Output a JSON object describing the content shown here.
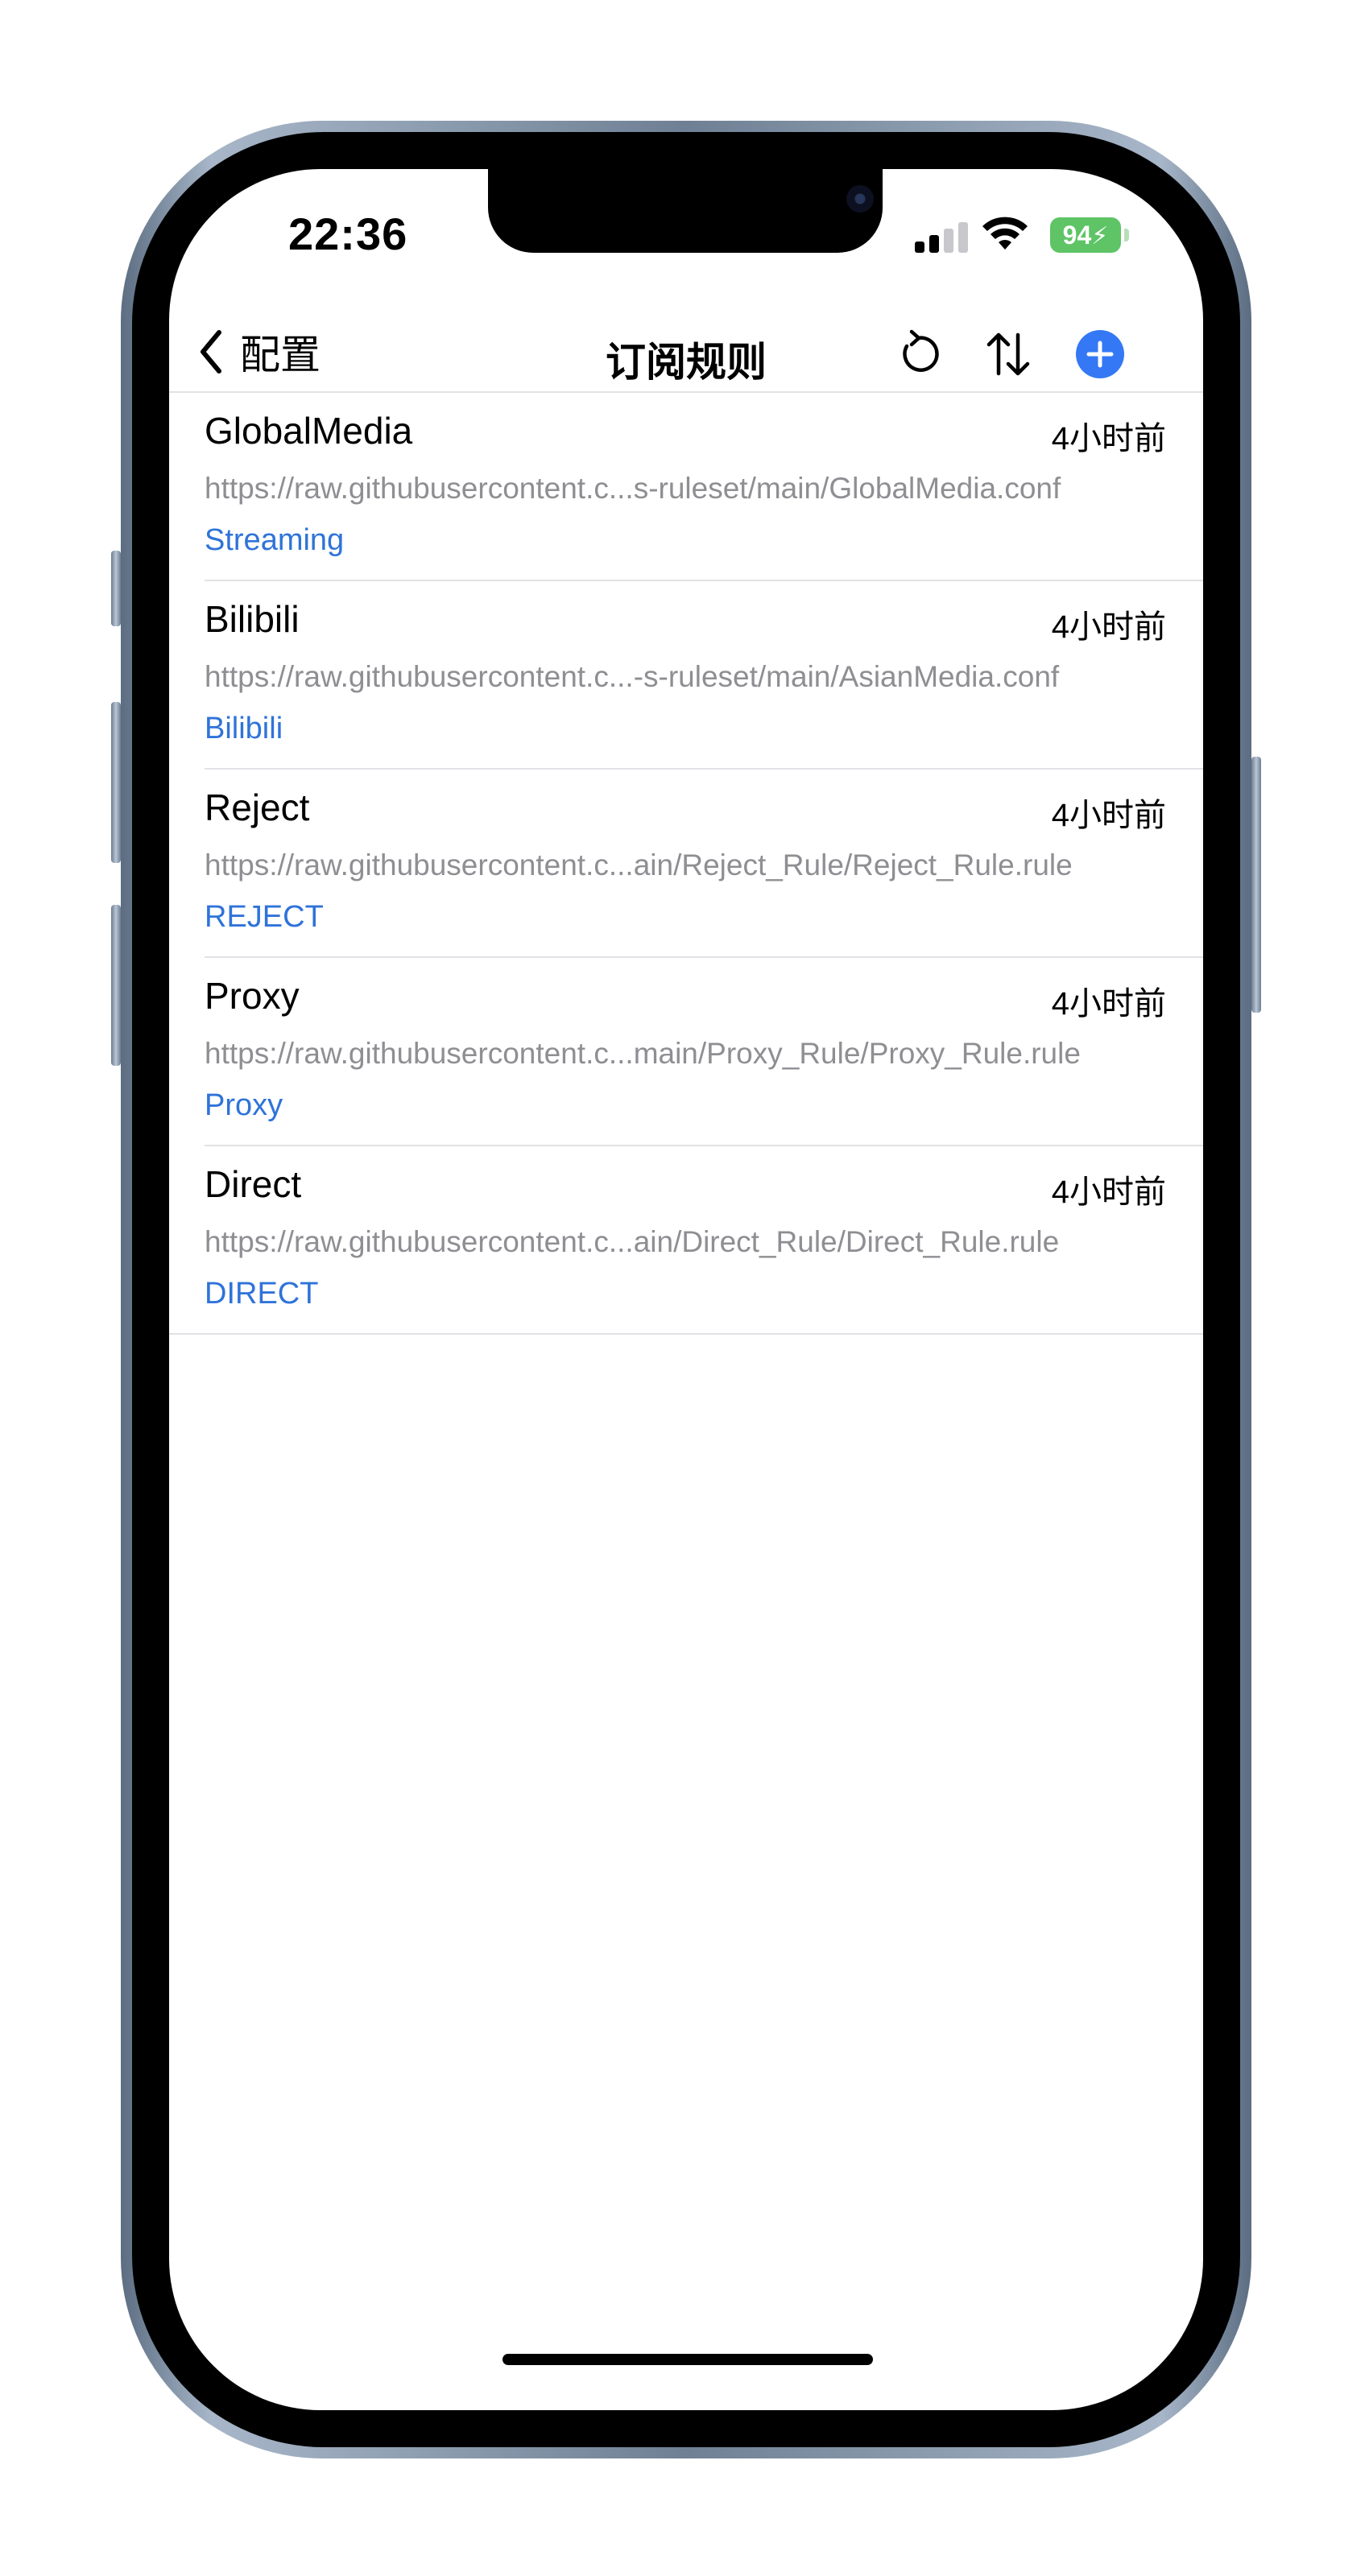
{
  "status_bar": {
    "time": "22:36",
    "battery": "94",
    "battery_color": "#5ec466"
  },
  "nav": {
    "back_label": "配置",
    "title": "订阅规则",
    "icons": [
      "chevron-left-icon",
      "refresh-icon",
      "sort-icon",
      "add-icon"
    ],
    "accent_color": "#3478f6"
  },
  "rules": [
    {
      "name": "GlobalMedia",
      "time": "4小时前",
      "url": "https://raw.githubusercontent.c...s-ruleset/main/GlobalMedia.conf",
      "policy": "Streaming"
    },
    {
      "name": "Bilibili",
      "time": "4小时前",
      "url": "https://raw.githubusercontent.c...-s-ruleset/main/AsianMedia.conf",
      "policy": "Bilibili"
    },
    {
      "name": "Reject",
      "time": "4小时前",
      "url": "https://raw.githubusercontent.c...ain/Reject_Rule/Reject_Rule.rule",
      "policy": "REJECT"
    },
    {
      "name": "Proxy",
      "time": "4小时前",
      "url": "https://raw.githubusercontent.c...main/Proxy_Rule/Proxy_Rule.rule",
      "policy": "Proxy"
    },
    {
      "name": "Direct",
      "time": "4小时前",
      "url": "https://raw.githubusercontent.c...ain/Direct_Rule/Direct_Rule.rule",
      "policy": "DIRECT"
    }
  ],
  "colors": {
    "link_blue": "#2f73d9",
    "secondary_gray": "#8e8e93"
  }
}
